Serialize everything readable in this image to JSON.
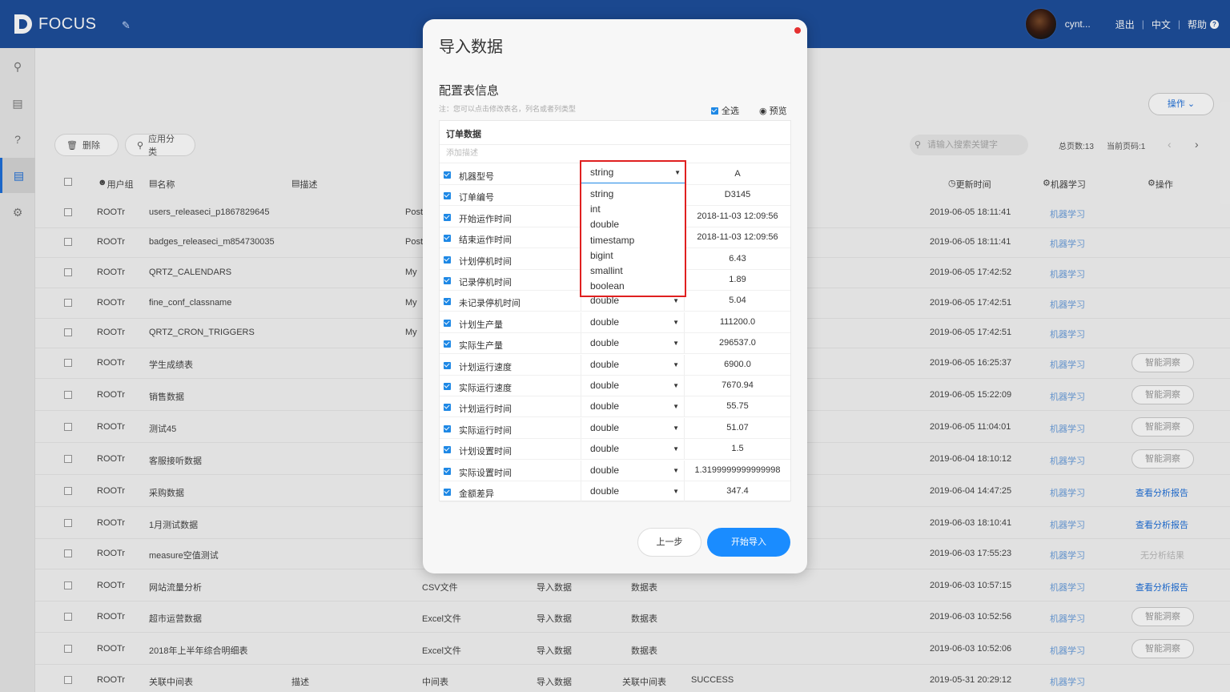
{
  "app": {
    "brand": "FOCUS"
  },
  "topbar": {
    "username": "cynt...",
    "logout": "退出",
    "language": "中文",
    "help": "帮助"
  },
  "toolbar": {
    "delete_label": "删除",
    "apply_category_label": "应用分类",
    "operations_label": "操作",
    "search_placeholder": "请输入搜索关键字",
    "total_pages": "总页数:13",
    "current_page": "当前页码:1"
  },
  "list_headers": {
    "user_group": "用户组",
    "name": "名称",
    "description": "描述",
    "update_time": "更新时间",
    "ml": "机器学习",
    "ops": "操作"
  },
  "rows": [
    {
      "group": "ROOTr",
      "name": "users_releaseci_p1867829645",
      "c3": "Post",
      "time": "2019-06-05 18:11:41",
      "ml": "机器学习",
      "action": ""
    },
    {
      "group": "ROOTr",
      "name": "badges_releaseci_m854730035",
      "c3": "Post",
      "time": "2019-06-05 18:11:41",
      "ml": "机器学习",
      "action": ""
    },
    {
      "group": "ROOTr",
      "name": "QRTZ_CALENDARS",
      "c3": "My",
      "time": "2019-06-05 17:42:52",
      "ml": "机器学习",
      "action": ""
    },
    {
      "group": "ROOTr",
      "name": "fine_conf_classname",
      "c3": "My",
      "time": "2019-06-05 17:42:51",
      "ml": "机器学习",
      "action": ""
    },
    {
      "group": "ROOTr",
      "name": "QRTZ_CRON_TRIGGERS",
      "c3": "My",
      "time": "2019-06-05 17:42:51",
      "ml": "机器学习",
      "action": ""
    },
    {
      "group": "ROOTr",
      "name": "学生成绩表",
      "c3": "",
      "time": "2019-06-05 16:25:37",
      "ml": "机器学习",
      "action": "智能洞察"
    },
    {
      "group": "ROOTr",
      "name": "销售数据",
      "c3": "",
      "time": "2019-06-05 15:22:09",
      "ml": "机器学习",
      "action": "智能洞察"
    },
    {
      "group": "ROOTr",
      "name": "测试45",
      "c3": "",
      "time": "2019-06-05 11:04:01",
      "ml": "机器学习",
      "action": "智能洞察"
    },
    {
      "group": "ROOTr",
      "name": "客服接听数据",
      "c3": "",
      "time": "2019-06-04 18:10:12",
      "ml": "机器学习",
      "action": "智能洞察"
    },
    {
      "group": "ROOTr",
      "name": "采购数据",
      "c3": "",
      "time": "2019-06-04 14:47:25",
      "ml": "机器学习",
      "action": "查看分析报告"
    },
    {
      "group": "ROOTr",
      "name": "1月测试数据",
      "c3": "",
      "time": "2019-06-03 18:10:41",
      "ml": "机器学习",
      "action": "查看分析报告"
    },
    {
      "group": "ROOTr",
      "name": "measure空值测试",
      "c3": "",
      "time": "2019-06-03 17:55:23",
      "ml": "机器学习",
      "action": "无分析结果"
    },
    {
      "group": "ROOTr",
      "name": "网站流量分析",
      "c3": "",
      "c4": "CSV文件",
      "c5": "导入数据",
      "c6": "数据表",
      "time": "2019-06-03 10:57:15",
      "ml": "机器学习",
      "action": "查看分析报告"
    },
    {
      "group": "ROOTr",
      "name": "超市运营数据",
      "c3": "",
      "c4": "Excel文件",
      "c5": "导入数据",
      "c6": "数据表",
      "time": "2019-06-03 10:52:56",
      "ml": "机器学习",
      "action": "智能洞察"
    },
    {
      "group": "ROOTr",
      "name": "2018年上半年综合明细表",
      "c3": "",
      "c4": "Excel文件",
      "c5": "导入数据",
      "c6": "数据表",
      "time": "2019-06-03 10:52:06",
      "ml": "机器学习",
      "action": "智能洞察"
    },
    {
      "group": "ROOTr",
      "name": "关联中间表",
      "c3": "描述",
      "c4": "中间表",
      "c5": "导入数据",
      "c6": "关联中间表",
      "c7": "SUCCESS",
      "time": "2019-05-31 20:29:12",
      "ml": "机器学习",
      "action": ""
    }
  ],
  "modal": {
    "title": "导入数据",
    "section_title": "配置表信息",
    "note": "注：您可以点击修改表名，列名或者列类型",
    "select_all": "全选",
    "preview": "预览",
    "table_name": "订单数据",
    "description_placeholder": "添加描述",
    "prev_label": "上一步",
    "start_label": "开始导入",
    "fields": [
      {
        "name": "机器型号",
        "type": "string",
        "sample": "A"
      },
      {
        "name": "订单编号",
        "type": "string",
        "sample": "D3145"
      },
      {
        "name": "开始运作时间",
        "type": "timestamp",
        "sample": "2018-11-03 12:09:56"
      },
      {
        "name": "结束运作时间",
        "type": "timestamp",
        "sample": "2018-11-03 12:09:56"
      },
      {
        "name": "计划停机时间",
        "type": "double",
        "sample": "6.43"
      },
      {
        "name": "记录停机时间",
        "type": "double",
        "sample": "1.89"
      },
      {
        "name": "未记录停机时间",
        "type": "double",
        "sample": "5.04"
      },
      {
        "name": "计划生产量",
        "type": "double",
        "sample": "111200.0"
      },
      {
        "name": "实际生产量",
        "type": "double",
        "sample": "296537.0"
      },
      {
        "name": "计划运行速度",
        "type": "double",
        "sample": "6900.0"
      },
      {
        "name": "实际运行速度",
        "type": "double",
        "sample": "7670.94"
      },
      {
        "name": "计划运行时间",
        "type": "double",
        "sample": "55.75"
      },
      {
        "name": "实际运行时间",
        "type": "double",
        "sample": "51.07"
      },
      {
        "name": "计划设置时间",
        "type": "double",
        "sample": "1.5"
      },
      {
        "name": "实际设置时间",
        "type": "double",
        "sample": "1.3199999999999998"
      },
      {
        "name": "金额差异",
        "type": "double",
        "sample": "347.4"
      }
    ],
    "type_dropdown": {
      "selected": "string",
      "options": [
        "string",
        "int",
        "double",
        "timestamp",
        "bigint",
        "smallint",
        "boolean"
      ]
    }
  },
  "colors": {
    "topbar": "#1e4f9c",
    "accent": "#1a8cff",
    "highlight": "#e02020"
  }
}
